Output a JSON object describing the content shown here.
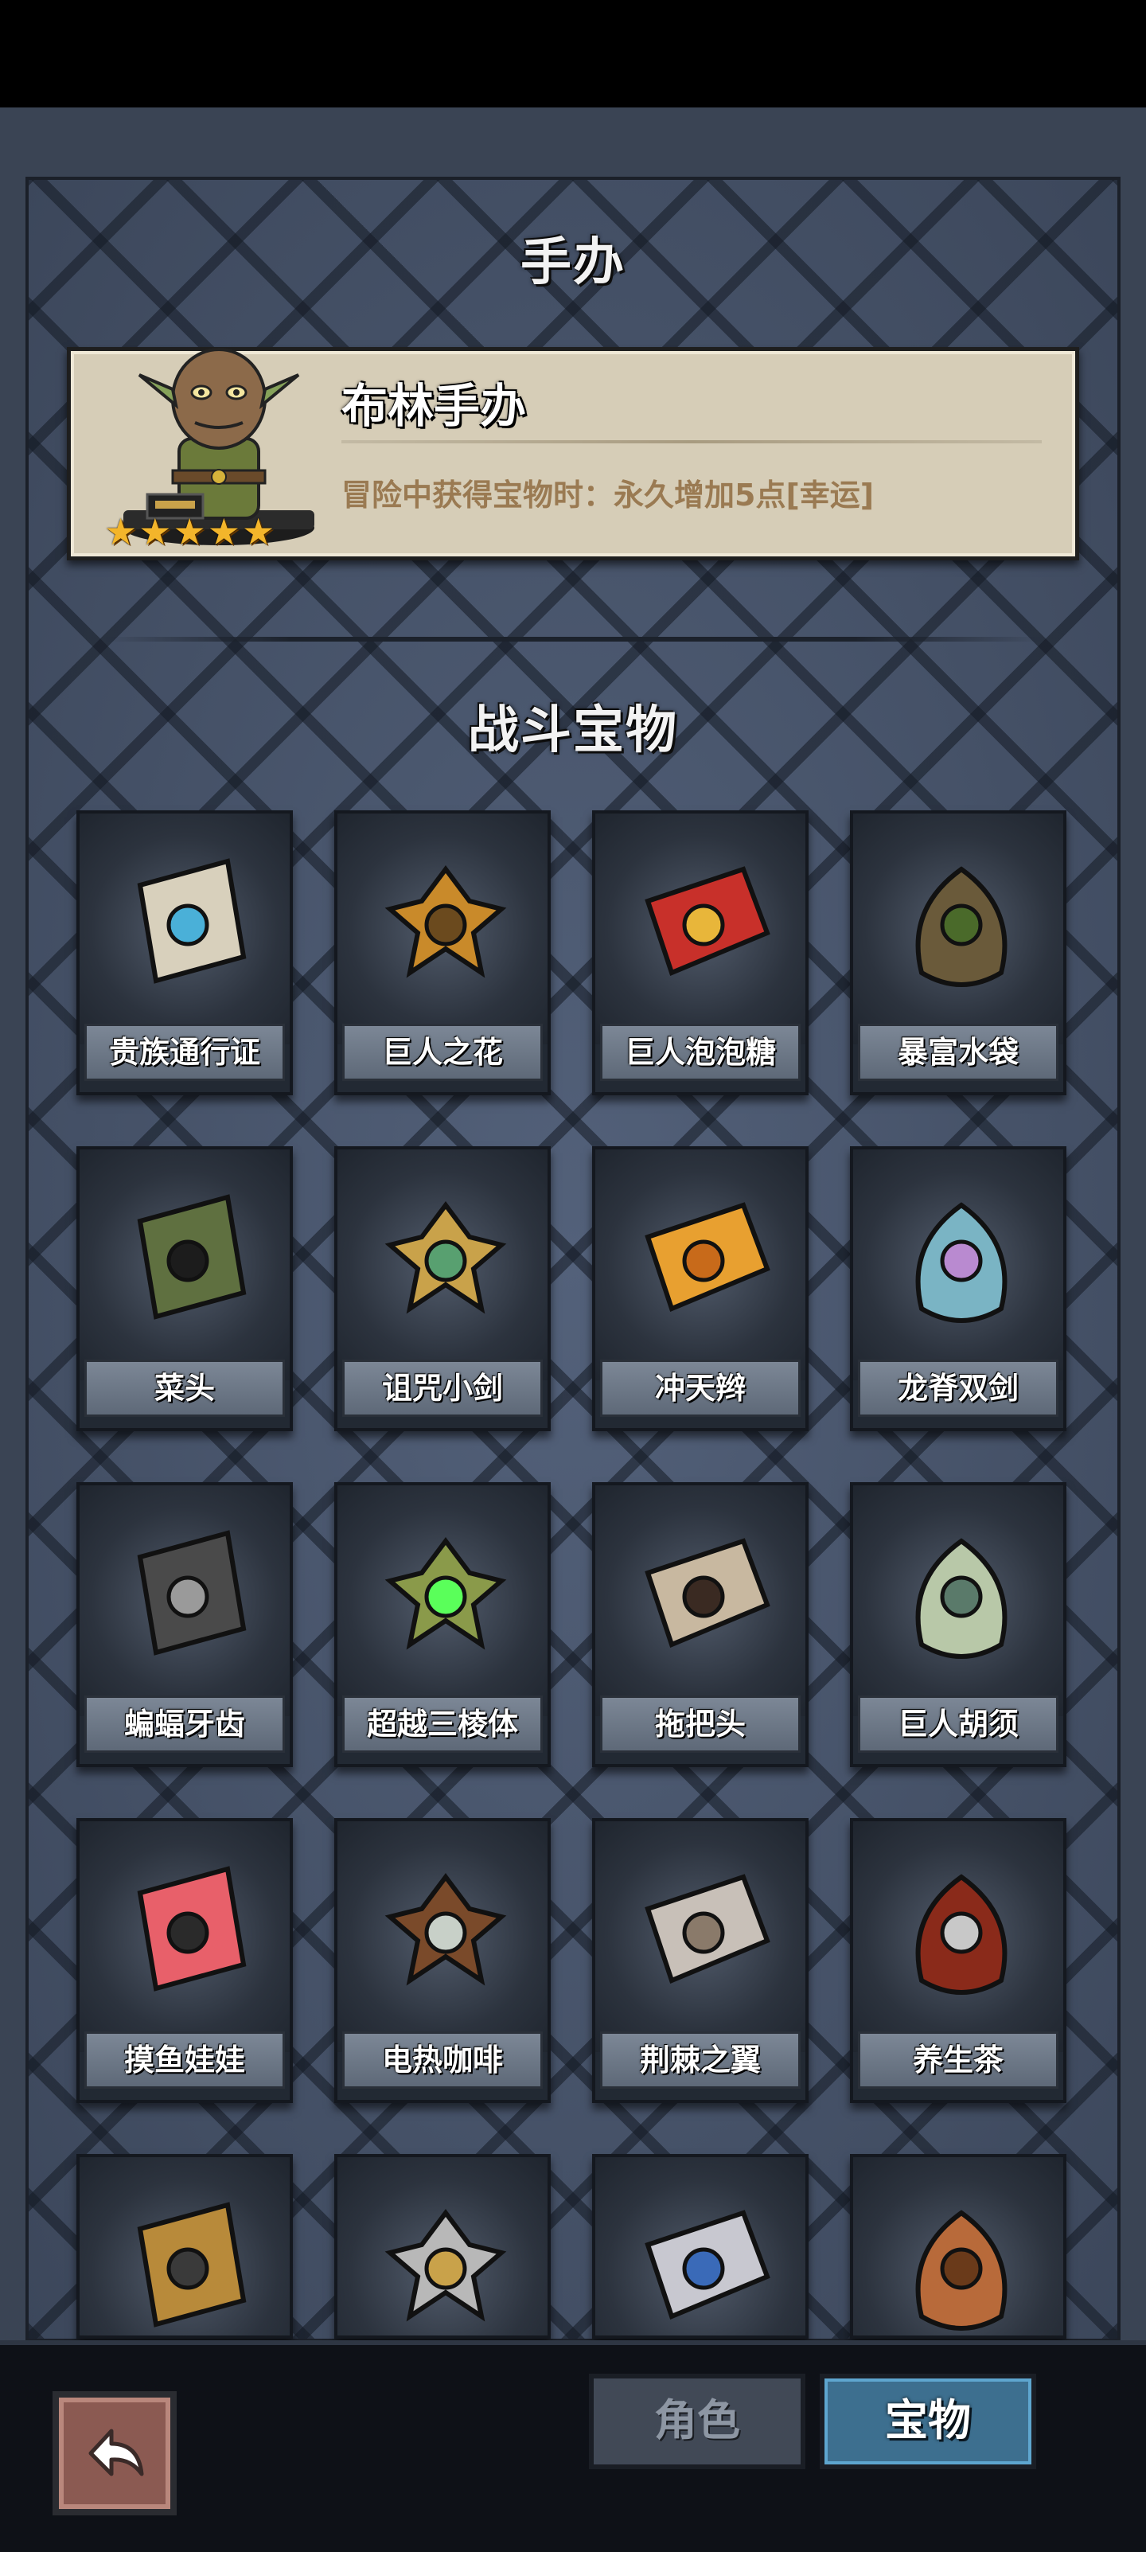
{
  "figure_section": {
    "title": "手办",
    "figure": {
      "name": "布林手办",
      "description": "冒险中获得宝物时：永久增加5点[幸运]",
      "stars": 5,
      "icon": "goblin-figurine-icon"
    }
  },
  "treasure_section": {
    "title": "战斗宝物",
    "items": [
      {
        "label": "贵族通行证",
        "icon": "card-icon"
      },
      {
        "label": "巨人之花",
        "icon": "flower-icon"
      },
      {
        "label": "巨人泡泡糖",
        "icon": "gum-box-icon"
      },
      {
        "label": "暴富水袋",
        "icon": "flask-icon"
      },
      {
        "label": "菜头",
        "icon": "spiky-ball-icon"
      },
      {
        "label": "诅咒小剑",
        "icon": "dagger-icon"
      },
      {
        "label": "冲天辫",
        "icon": "ponytail-icon"
      },
      {
        "label": "龙脊双剑",
        "icon": "twin-swords-icon"
      },
      {
        "label": "蝙蝠牙齿",
        "icon": "fangs-icon"
      },
      {
        "label": "超越三棱体",
        "icon": "prism-icon"
      },
      {
        "label": "拖把头",
        "icon": "mop-icon"
      },
      {
        "label": "巨人胡须",
        "icon": "beard-icon"
      },
      {
        "label": "摸鱼娃娃",
        "icon": "doll-icon"
      },
      {
        "label": "电热咖啡",
        "icon": "coffee-icon"
      },
      {
        "label": "荆棘之翼",
        "icon": "wings-icon"
      },
      {
        "label": "养生茶",
        "icon": "tea-icon"
      },
      {
        "label": "",
        "icon": "mask-icon"
      },
      {
        "label": "",
        "icon": "helmet-icon"
      },
      {
        "label": "",
        "icon": "kunai-icon"
      },
      {
        "label": "",
        "icon": "sack-icon"
      }
    ]
  },
  "tabs": {
    "role": "角色",
    "treasure": "宝物",
    "active": "treasure"
  },
  "colors": {
    "panel": "#47536a",
    "star": "#f3b52b",
    "active_tab": "#3d6f8f"
  }
}
